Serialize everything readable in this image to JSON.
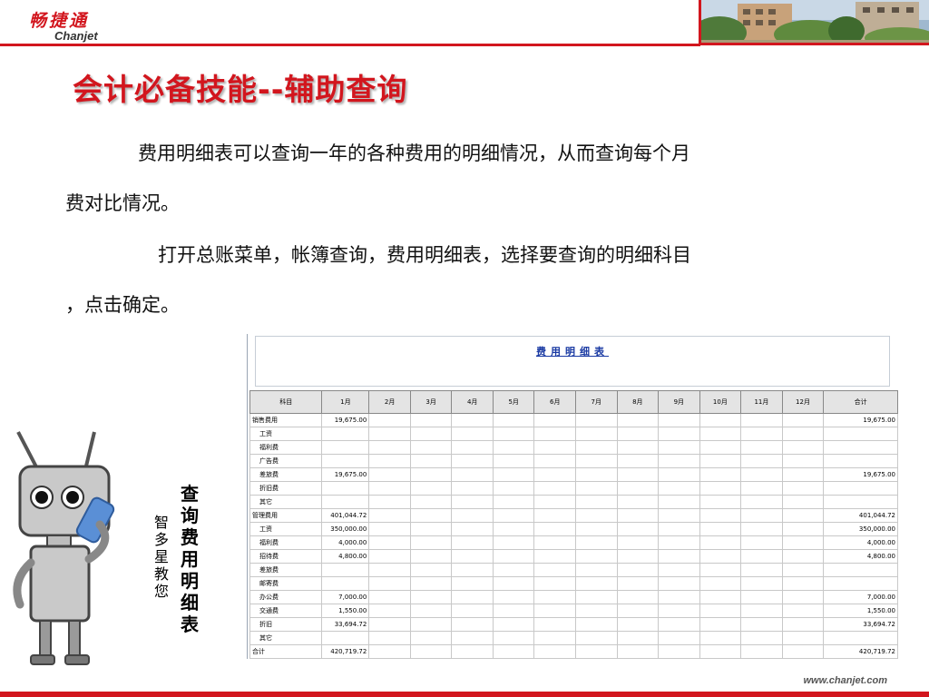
{
  "header": {
    "logo_cn": "畅捷通",
    "logo_en": "Chanjet"
  },
  "title": "会计必备技能--辅助查询",
  "paragraphs": {
    "p1_line1": "费用明细表可以查询一年的各种费用的明细情况，从而查询每个月",
    "p1_line2": "费对比情况。",
    "p2_line1": "打开总账菜单，帐簿查询，费用明细表，选择要查询的明细科目",
    "p2_line2": "，点击确定。"
  },
  "report": {
    "title": "费用明细表",
    "columns": [
      "科目",
      "1月",
      "2月",
      "3月",
      "4月",
      "5月",
      "6月",
      "7月",
      "8月",
      "9月",
      "10月",
      "11月",
      "12月",
      "合计"
    ],
    "rows": [
      {
        "name": "销售费用",
        "sub": false,
        "m1": "19,675.00",
        "total": "19,675.00"
      },
      {
        "name": "工资",
        "sub": true,
        "m1": "",
        "total": ""
      },
      {
        "name": "福利费",
        "sub": true,
        "m1": "",
        "total": ""
      },
      {
        "name": "广告费",
        "sub": true,
        "m1": "",
        "total": ""
      },
      {
        "name": "差旅费",
        "sub": true,
        "m1": "19,675.00",
        "total": "19,675.00"
      },
      {
        "name": "折旧费",
        "sub": true,
        "m1": "",
        "total": ""
      },
      {
        "name": "其它",
        "sub": true,
        "m1": "",
        "total": ""
      },
      {
        "name": "管理费用",
        "sub": false,
        "m1": "401,044.72",
        "total": "401,044.72"
      },
      {
        "name": "工资",
        "sub": true,
        "m1": "350,000.00",
        "total": "350,000.00"
      },
      {
        "name": "福利费",
        "sub": true,
        "m1": "4,000.00",
        "total": "4,000.00"
      },
      {
        "name": "招待费",
        "sub": true,
        "m1": "4,800.00",
        "total": "4,800.00"
      },
      {
        "name": "差旅费",
        "sub": true,
        "m1": "",
        "total": ""
      },
      {
        "name": "邮寄费",
        "sub": true,
        "m1": "",
        "total": ""
      },
      {
        "name": "办公费",
        "sub": true,
        "m1": "7,000.00",
        "total": "7,000.00"
      },
      {
        "name": "交通费",
        "sub": true,
        "m1": "1,550.00",
        "total": "1,550.00"
      },
      {
        "name": "折旧",
        "sub": true,
        "m1": "33,694.72",
        "total": "33,694.72"
      },
      {
        "name": "其它",
        "sub": true,
        "m1": "",
        "total": ""
      },
      {
        "name": "合计",
        "sub": false,
        "m1": "420,719.72",
        "total": "420,719.72"
      }
    ]
  },
  "captions": {
    "main": "查询费用明细表",
    "sub": "智多星教您"
  },
  "footer": {
    "url": "www.chanjet.com"
  },
  "colors": {
    "brand_red": "#d2161e",
    "report_title_blue": "#1a3aa3"
  }
}
